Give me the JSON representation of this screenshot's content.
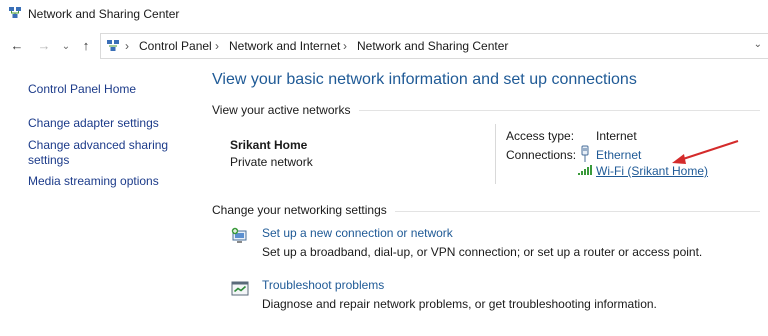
{
  "window": {
    "title": "Network and Sharing Center"
  },
  "address_bar": {
    "breadcrumbs": [
      "Control Panel",
      "Network and Internet",
      "Network and Sharing Center"
    ]
  },
  "sidebar": {
    "items": [
      {
        "label": "Control Panel Home"
      },
      {
        "label": "Change adapter settings"
      },
      {
        "label": "Change advanced sharing settings"
      },
      {
        "label": "Media streaming options"
      }
    ]
  },
  "main": {
    "title": "View your basic network information and set up connections",
    "active_networks": {
      "section_label": "View your active networks",
      "network_name": "Srikant Home",
      "network_category": "Private network",
      "access_type_label": "Access type:",
      "access_type_value": "Internet",
      "connections_label": "Connections:",
      "connections": [
        {
          "label": "Ethernet",
          "icon": "ethernet-icon"
        },
        {
          "label": "Wi-Fi (Srikant Home)",
          "icon": "wifi-signal-icon"
        }
      ]
    },
    "change_settings": {
      "section_label": "Change your networking settings",
      "tasks": [
        {
          "link": "Set up a new connection or network",
          "description": "Set up a broadband, dial-up, or VPN connection; or set up a router or access point.",
          "icon": "new-connection-icon"
        },
        {
          "link": "Troubleshoot problems",
          "description": "Diagnose and repair network problems, or get troubleshooting information.",
          "icon": "troubleshoot-icon"
        }
      ]
    }
  },
  "colors": {
    "link": "#1f5a96",
    "sidebar_link": "#1c3b8a",
    "annotation_arrow": "#d42b2b"
  }
}
